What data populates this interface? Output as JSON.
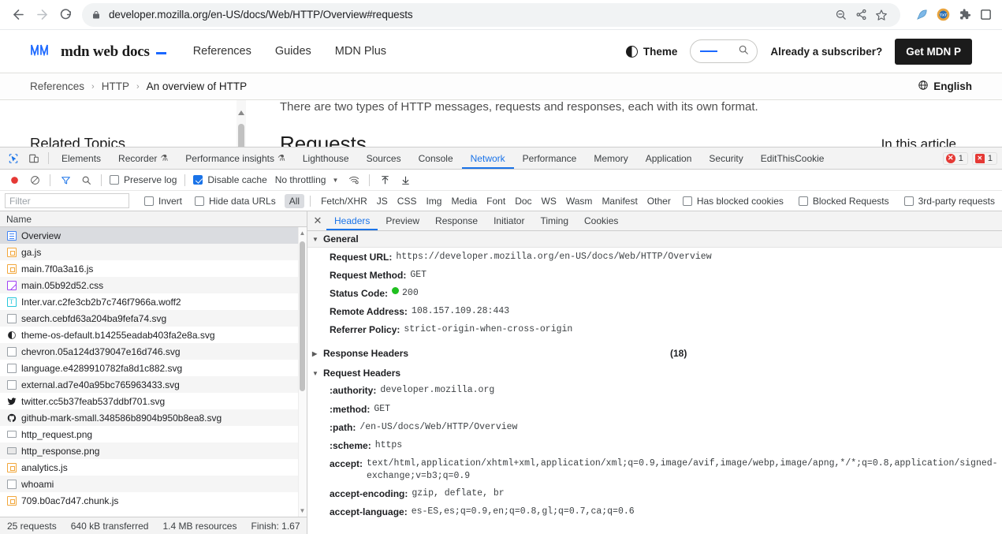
{
  "browser": {
    "back_icon": "back-arrow-icon",
    "forward_icon": "forward-arrow-icon",
    "reload_icon": "reload-icon",
    "lock_icon": "lock-icon",
    "url": "developer.mozilla.org/en-US/docs/Web/HTTP/Overview#requests",
    "omni_actions": [
      "zoom-out-icon",
      "share-icon",
      "bookmark-star-icon"
    ],
    "extensions": [
      "feather-extension-icon",
      "txt-extension-icon",
      "puzzle-extensions-icon",
      "profile-icon"
    ]
  },
  "mdn": {
    "logo_text": "mdn web docs",
    "nav": [
      {
        "label": "References"
      },
      {
        "label": "Guides"
      },
      {
        "label": "MDN Plus"
      }
    ],
    "theme_label": "Theme",
    "search_placeholder": "",
    "subscriber_text": "Already a subscriber?",
    "cta_label": "Get MDN P",
    "breadcrumbs": [
      {
        "label": "References"
      },
      {
        "label": "HTTP"
      },
      {
        "label": "An overview of HTTP"
      }
    ],
    "breadcrumb_sep": "›",
    "locale_label": "English",
    "sidebar_heading": "Related Topics",
    "paragraph": "There are two types of HTTP messages, requests and responses, each with its own format.",
    "section_heading": "Requests",
    "toc_heading": "In this article"
  },
  "devtools": {
    "inspect_icon": "inspect-element-icon",
    "device_icon": "device-toolbar-icon",
    "tabs": [
      {
        "label": "Elements",
        "flask": false,
        "selected": false
      },
      {
        "label": "Recorder",
        "flask": true,
        "selected": false
      },
      {
        "label": "Performance insights",
        "flask": true,
        "selected": false
      },
      {
        "label": "Lighthouse",
        "flask": false,
        "selected": false
      },
      {
        "label": "Sources",
        "flask": false,
        "selected": false
      },
      {
        "label": "Console",
        "flask": false,
        "selected": false
      },
      {
        "label": "Network",
        "flask": false,
        "selected": true
      },
      {
        "label": "Performance",
        "flask": false,
        "selected": false
      },
      {
        "label": "Memory",
        "flask": false,
        "selected": false
      },
      {
        "label": "Application",
        "flask": false,
        "selected": false
      },
      {
        "label": "Security",
        "flask": false,
        "selected": false
      },
      {
        "label": "EditThisCookie",
        "flask": false,
        "selected": false
      }
    ],
    "flask_glyph": "⚗",
    "error_badge": {
      "count": "1",
      "glyph": "✕"
    },
    "issue_badge": {
      "count": "1",
      "glyph": "✕"
    },
    "toolbar": {
      "record_icon": "record-stop-icon",
      "clear_icon": "clear-network-log-icon",
      "filter_icon": "filter-icon",
      "search_icon": "search-icon",
      "preserve_log_label": "Preserve log",
      "preserve_log_checked": false,
      "disable_cache_label": "Disable cache",
      "disable_cache_checked": true,
      "throttling_label": "No throttling",
      "throttle_caret": "▼",
      "wifi_icon": "network-conditions-icon",
      "import_icon": "import-har-icon",
      "export_icon": "export-har-icon"
    },
    "filterbar": {
      "filter_placeholder": "Filter",
      "filter_value": "",
      "invert_label": "Invert",
      "invert_checked": false,
      "hide_data_urls_label": "Hide data URLs",
      "hide_data_urls_checked": false,
      "types": [
        {
          "label": "All",
          "active": true
        },
        {
          "label": "Fetch/XHR",
          "active": false
        },
        {
          "label": "JS",
          "active": false
        },
        {
          "label": "CSS",
          "active": false
        },
        {
          "label": "Img",
          "active": false
        },
        {
          "label": "Media",
          "active": false
        },
        {
          "label": "Font",
          "active": false
        },
        {
          "label": "Doc",
          "active": false
        },
        {
          "label": "WS",
          "active": false
        },
        {
          "label": "Wasm",
          "active": false
        },
        {
          "label": "Manifest",
          "active": false
        },
        {
          "label": "Other",
          "active": false
        }
      ],
      "has_blocked_cookies_label": "Has blocked cookies",
      "has_blocked_cookies_checked": false,
      "blocked_requests_label": "Blocked Requests",
      "blocked_requests_checked": false,
      "third_party_label": "3rd-party requests",
      "third_party_checked": false
    },
    "requests": {
      "column_header": "Name",
      "rows": [
        {
          "name": "Overview",
          "icon": "document-icon",
          "selected": true
        },
        {
          "name": "ga.js",
          "icon": "js-file-icon",
          "selected": false
        },
        {
          "name": "main.7f0a3a16.js",
          "icon": "js-file-icon",
          "selected": false
        },
        {
          "name": "main.05b92d52.css",
          "icon": "css-file-icon",
          "selected": false
        },
        {
          "name": "Inter.var.c2fe3cb2b7c746f7966a.woff2",
          "icon": "font-file-icon",
          "selected": false
        },
        {
          "name": "search.cebfd63a204ba9fefa74.svg",
          "icon": "image-file-icon",
          "selected": false
        },
        {
          "name": "theme-os-default.b14255eadab403fa2e8a.svg",
          "icon": "theme-image-icon",
          "selected": false
        },
        {
          "name": "chevron.05a124d379047e16d746.svg",
          "icon": "image-file-icon",
          "selected": false
        },
        {
          "name": "language.e4289910782fa8d1c882.svg",
          "icon": "image-file-icon",
          "selected": false
        },
        {
          "name": "external.ad7e40a95bc765963433.svg",
          "icon": "image-file-icon",
          "selected": false
        },
        {
          "name": "twitter.cc5b37feab537ddbf701.svg",
          "icon": "twitter-image-icon",
          "selected": false
        },
        {
          "name": "github-mark-small.348586b8904b950b8ea8.svg",
          "icon": "github-image-icon",
          "selected": false
        },
        {
          "name": "http_request.png",
          "icon": "png-file-icon",
          "selected": false
        },
        {
          "name": "http_response.png",
          "icon": "png-file-icon",
          "selected": false
        },
        {
          "name": "analytics.js",
          "icon": "js-file-icon",
          "selected": false
        },
        {
          "name": "whoami",
          "icon": "xhr-file-icon",
          "selected": false
        },
        {
          "name": "709.b0ac7d47.chunk.js",
          "icon": "js-file-icon",
          "selected": false
        }
      ]
    },
    "status_bar": [
      {
        "label": "25 requests"
      },
      {
        "label": "640 kB transferred"
      },
      {
        "label": "1.4 MB resources"
      },
      {
        "label": "Finish: 1.67"
      }
    ],
    "detail": {
      "close_glyph": "✕",
      "tabs": [
        {
          "label": "Headers",
          "selected": true
        },
        {
          "label": "Preview",
          "selected": false
        },
        {
          "label": "Response",
          "selected": false
        },
        {
          "label": "Initiator",
          "selected": false
        },
        {
          "label": "Timing",
          "selected": false
        },
        {
          "label": "Cookies",
          "selected": false
        }
      ],
      "general": {
        "title": "General",
        "expanded": true,
        "tri_open": "▼",
        "rows": [
          {
            "key": "Request URL:",
            "value": "https://developer.mozilla.org/en-US/docs/Web/HTTP/Overview"
          },
          {
            "key": "Request Method:",
            "value": "GET"
          },
          {
            "key": "Status Code:",
            "value": "200",
            "status_dot": true
          },
          {
            "key": "Remote Address:",
            "value": "108.157.109.28:443"
          },
          {
            "key": "Referrer Policy:",
            "value": "strict-origin-when-cross-origin"
          }
        ]
      },
      "response_headers": {
        "title": "Response Headers",
        "count": "(18)",
        "expanded": false,
        "tri_closed": "▶"
      },
      "request_headers": {
        "title": "Request Headers",
        "expanded": true,
        "tri_open": "▼",
        "rows": [
          {
            "key": ":authority:",
            "value": "developer.mozilla.org"
          },
          {
            "key": ":method:",
            "value": "GET"
          },
          {
            "key": ":path:",
            "value": "/en-US/docs/Web/HTTP/Overview"
          },
          {
            "key": ":scheme:",
            "value": "https"
          },
          {
            "key": "accept:",
            "value": "text/html,application/xhtml+xml,application/xml;q=0.9,image/avif,image/webp,image/apng,*/*;q=0.8,application/signed-exchange;v=b3;q=0.9"
          },
          {
            "key": "accept-encoding:",
            "value": "gzip, deflate, br"
          },
          {
            "key": "accept-language:",
            "value": "es-ES,es;q=0.9,en;q=0.8,gl;q=0.7,ca;q=0.6"
          }
        ]
      }
    }
  }
}
